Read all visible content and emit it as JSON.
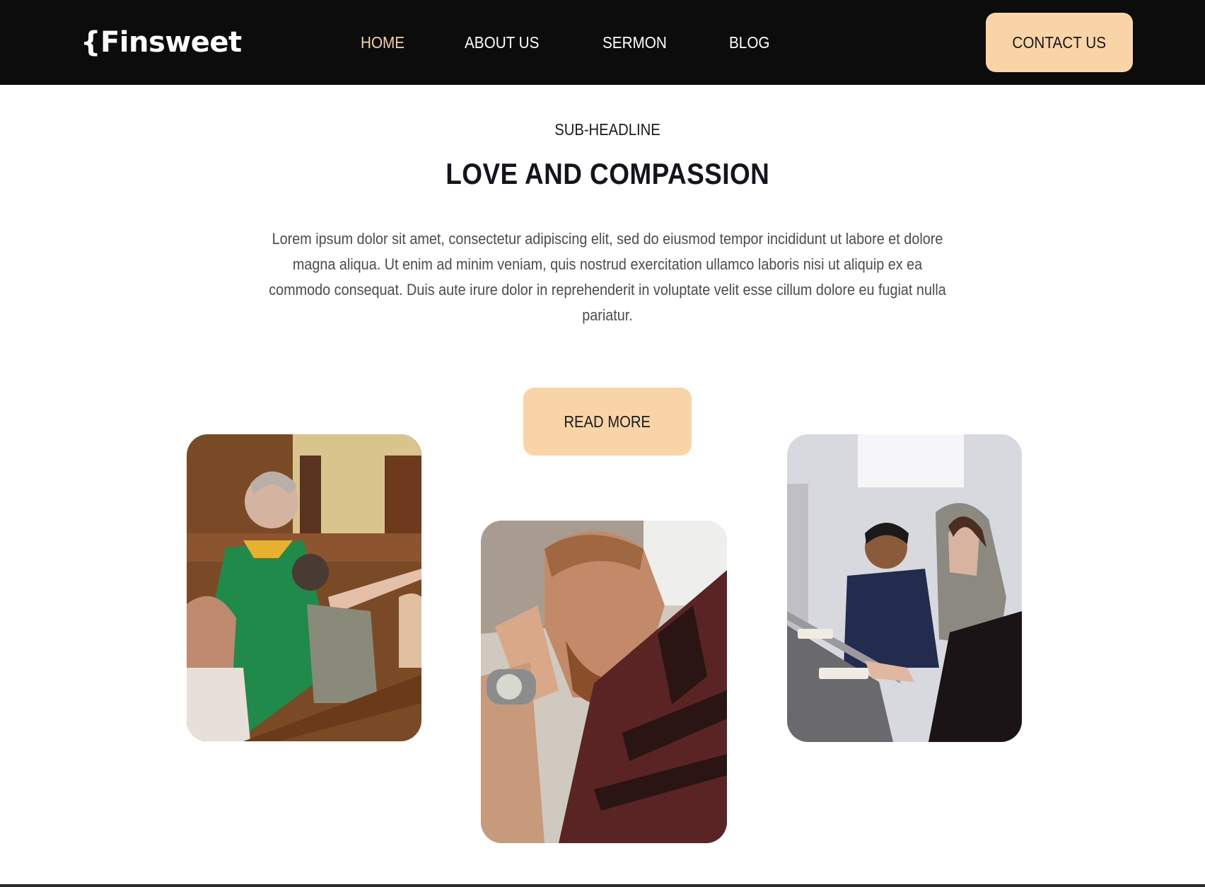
{
  "nav": {
    "logo": "{Finsweet",
    "links": [
      {
        "label": "HOME",
        "active": true
      },
      {
        "label": "ABOUT US",
        "active": false
      },
      {
        "label": "SERMON",
        "active": false
      },
      {
        "label": "BLOG",
        "active": false
      }
    ],
    "contact_label": "CONTACT US"
  },
  "hero": {
    "subheadline": "SUB-HEADLINE",
    "title": "LOVE AND COMPASSION",
    "body": "Lorem ipsum dolor sit amet, consectetur adipiscing elit, sed do eiusmod tempor incididunt ut labore et dolore magna aliqua. Ut enim ad minim veniam, quis nostrud exercitation ullamco laboris nisi ut aliquip ex ea commodo consequat. Duis aute irure dolor in reprehenderit in voluptate velit esse cillum dolore eu fugiat nulla pariatur.",
    "read_more_label": "READ MORE"
  },
  "colors": {
    "nav_bg": "#0c0c0c",
    "accent": "#f8d4a6",
    "active_link": "#f6d3a4",
    "title": "#14141f",
    "body_text": "#4b4b50"
  },
  "photos": [
    {
      "subject": "pastor-blessing-congregation-photo"
    },
    {
      "subject": "man-praying-photo"
    },
    {
      "subject": "couple-reading-bible-photo"
    }
  ]
}
